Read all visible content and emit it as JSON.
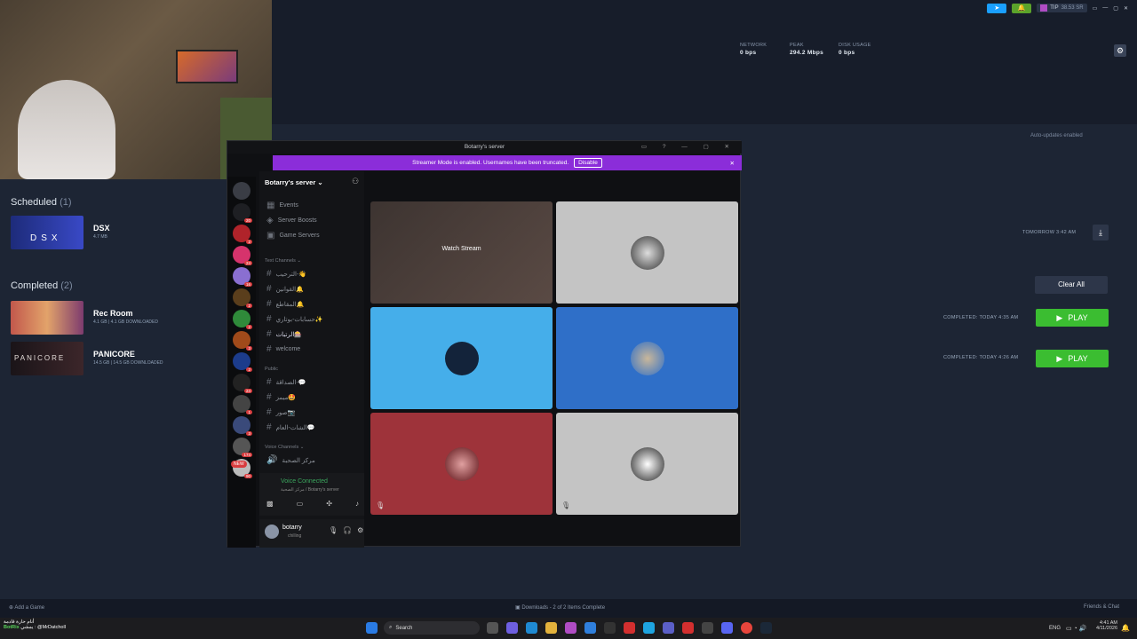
{
  "topbar": {
    "tip_label": "TIP",
    "balance": "38.53 SR"
  },
  "stats": [
    {
      "label": "NETWORK",
      "value": "0 bps"
    },
    {
      "label": "PEAK",
      "value": "294.2 Mbps"
    },
    {
      "label": "DISK USAGE",
      "value": "0 bps"
    }
  ],
  "auto_updates": "Auto-updates enabled",
  "scheduled": {
    "title": "Scheduled",
    "count": "(1)",
    "game": {
      "name": "DSX",
      "size": "4.7 MB",
      "time": "TOMORROW 3:42 AM",
      "thumb_text": "DSX"
    }
  },
  "completed": {
    "title": "Completed",
    "count": "(2)",
    "clear_all": "Clear All",
    "games": [
      {
        "name": "Rec Room",
        "size": "4.1 GB | 4.1 GB DOWNLOADED",
        "status": "COMPLETED: TODAY 4:35 AM",
        "play": "PLAY"
      },
      {
        "name": "PANICORE",
        "size": "14.5 GB | 14.5 GB DOWNLOADED",
        "status": "COMPLETED: TODAY 4:26 AM",
        "play": "PLAY",
        "thumb_text": "PANICORE"
      }
    ]
  },
  "discord": {
    "window_title": "Botarry's server",
    "banner": "Streamer Mode is enabled. Usernames have been truncated.",
    "banner_button": "Disable",
    "server_name": "Botarry's server",
    "menu": [
      "Events",
      "Server Boosts",
      "Game Servers"
    ],
    "text_category": "Text Channels",
    "text_channels": [
      "الترحيب-👋",
      "القوانين🔔",
      "المقاطع🔔",
      "حسابات-بوتاري✨",
      "الرتبات🎰",
      "welcome"
    ],
    "public_category": "Public",
    "public_channels": [
      "الصداقة-💬",
      "ميمز🤩",
      "صور📷",
      "الشات-العام💬"
    ],
    "voice_category": "Voice Channels",
    "voice_channel": "مركز الصحبة",
    "voice_status": "Voice Connected",
    "voice_sub": "مركز الصحبة / Botarry's server",
    "user_name": "botarry",
    "user_status": "chilling",
    "watch_stream": "Watch Stream",
    "new_badge": "NEW",
    "badges": [
      "20",
      "2",
      "24",
      "16",
      "2",
      "2",
      "3",
      "2",
      "24",
      "1",
      "3",
      "174",
      "90"
    ]
  },
  "steam_bottom": {
    "add_game": "Add a Game",
    "downloads": "Downloads - 2 of 2 Items Complete",
    "friends": "Friends & Chat"
  },
  "taskbar": {
    "search": "Search",
    "lang": "ENG",
    "time": "4:41 AM",
    "date": "4/11/2026",
    "chat_line1": "أنام حارة قادمة",
    "chat_user": "BotRix",
    "chat_text": "يمشي : @MrDatcholl"
  }
}
